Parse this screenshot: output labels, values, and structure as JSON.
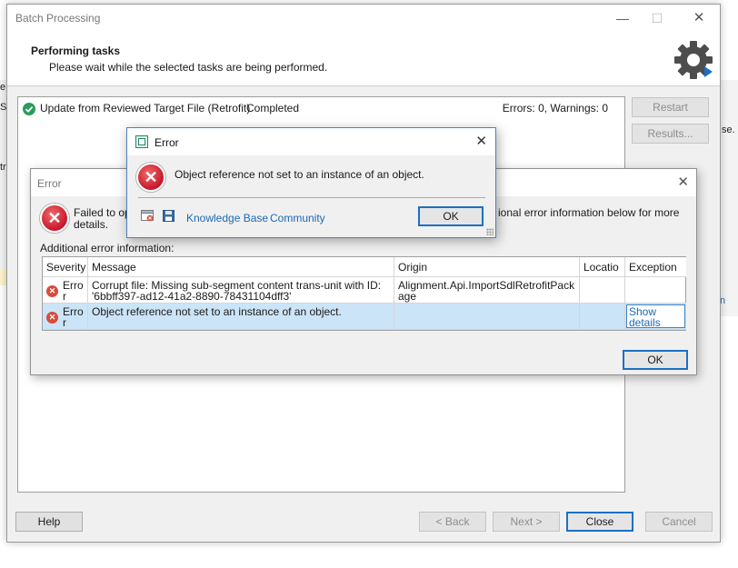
{
  "background_app": {
    "left_glyphs": [
      "e",
      "S",
      "tr"
    ],
    "right_glyphs": [
      "se.",
      "n"
    ]
  },
  "batch_window": {
    "title": "Batch Processing",
    "window_controls": {
      "minimize": "—",
      "maximize": "☐",
      "close": "✕"
    },
    "header": {
      "title": "Performing tasks",
      "subtitle": "Please wait while the selected tasks are being performed."
    },
    "task": {
      "name": "Update from Reviewed Target File (Retrofit)",
      "status": "Completed",
      "errors_summary": "Errors: 0, Warnings: 0"
    },
    "side_buttons": {
      "restart": "Restart",
      "results": "Results..."
    },
    "footer_buttons": {
      "help": "Help",
      "back": "< Back",
      "next": "Next >",
      "close": "Close",
      "cancel": "Cancel"
    }
  },
  "error_dialog_detail": {
    "title": "Error",
    "message_left": "Failed to ope\ndetails.",
    "message_right": "ional error information below for more",
    "additional_label": "Additional error information:",
    "columns": [
      "Severity",
      "Message",
      "Origin",
      "Locatio",
      "Exception"
    ],
    "rows": [
      {
        "severity": "Error",
        "message": "Corrupt file: Missing sub-segment content trans-unit with ID: '6bbff397-ad12-41a2-8890-78431104dff3'",
        "origin": "Alignment.Api.ImportSdlRetrofitPackage",
        "location": "",
        "exception": ""
      },
      {
        "severity": "Error",
        "message": "Object reference not set to an instance of an object.",
        "origin": "",
        "location": "",
        "exception": "Show details"
      }
    ],
    "ok": "OK"
  },
  "error_dialog_main": {
    "title": "Error",
    "message": "Object reference not set to an instance of an object.",
    "links": {
      "knowledge_base": "Knowledge Base",
      "community": "Community"
    },
    "ok": "OK"
  }
}
